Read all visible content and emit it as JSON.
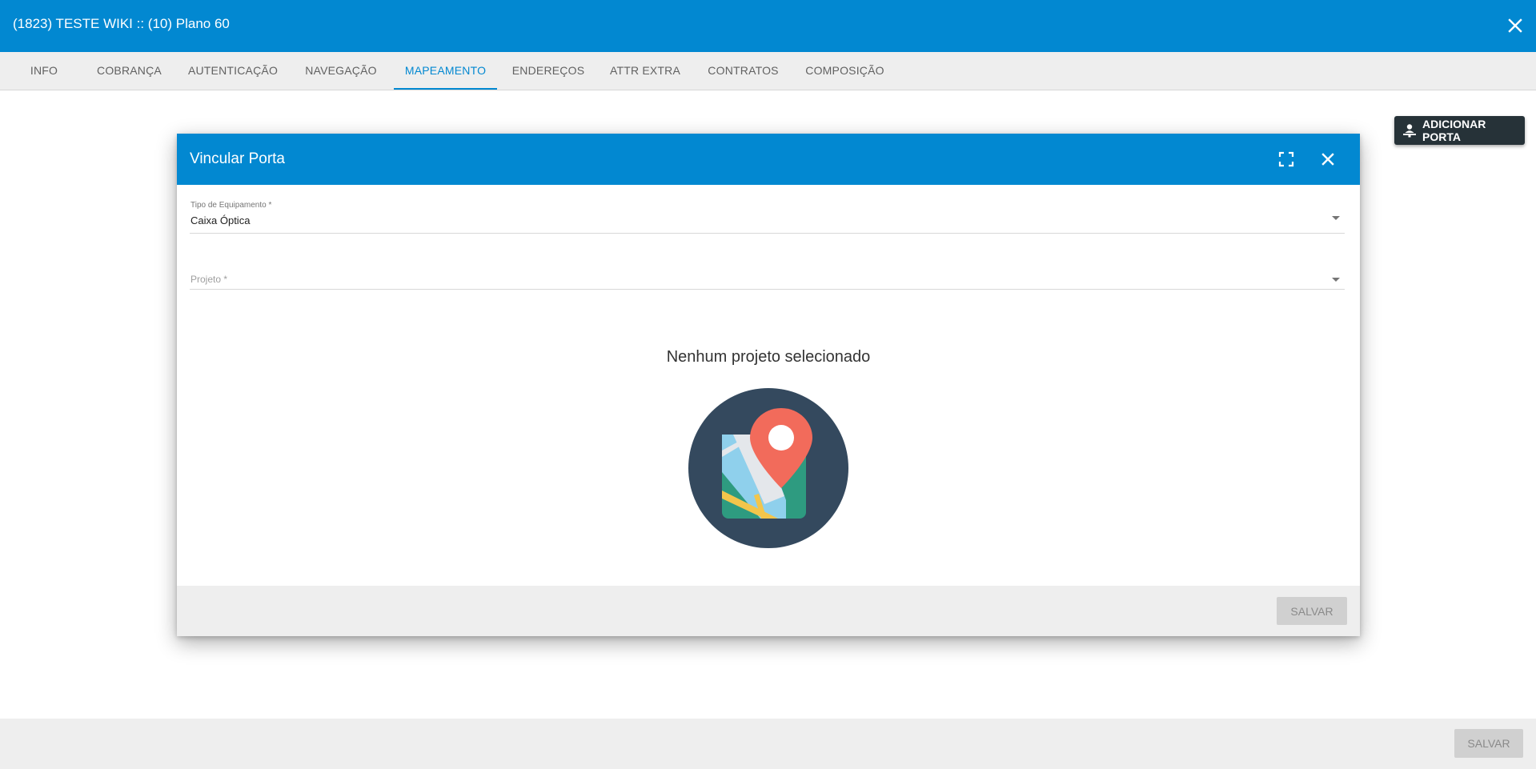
{
  "window": {
    "title": "(1823) TESTE WIKI :: (10) Plano 60",
    "close_icon": "close-icon"
  },
  "tabs": [
    {
      "label": "INFO"
    },
    {
      "label": "COBRANÇA"
    },
    {
      "label": "AUTENTICAÇÃO"
    },
    {
      "label": "NAVEGAÇÃO"
    },
    {
      "label": "MAPEAMENTO"
    },
    {
      "label": "ENDEREÇOS"
    },
    {
      "label": "ATTR EXTRA"
    },
    {
      "label": "CONTRATOS"
    },
    {
      "label": "COMPOSIÇÃO"
    }
  ],
  "active_tab": "MAPEAMENTO",
  "toolbar": {
    "add_port_label": "ADICIONAR PORTA",
    "add_port_icon": "person-pin-icon"
  },
  "modal": {
    "title": "Vincular Porta",
    "fullscreen_icon": "fullscreen-icon",
    "close_icon": "close-icon",
    "equipment_type": {
      "label": "Tipo de Equipamento *",
      "value": "Caixa Óptica"
    },
    "project": {
      "placeholder": "Projeto *",
      "value": ""
    },
    "empty_message": "Nenhum projeto selecionado",
    "illustration_icon": "map-pin-icon",
    "save_label": "SALVAR"
  },
  "footer": {
    "save_label": "SALVAR"
  },
  "colors": {
    "primary": "#0288d1",
    "dark_button": "#263238",
    "illustration_bg": "#34495e",
    "pin": "#f26b5b",
    "disabled_button": "#d0d0d0"
  }
}
